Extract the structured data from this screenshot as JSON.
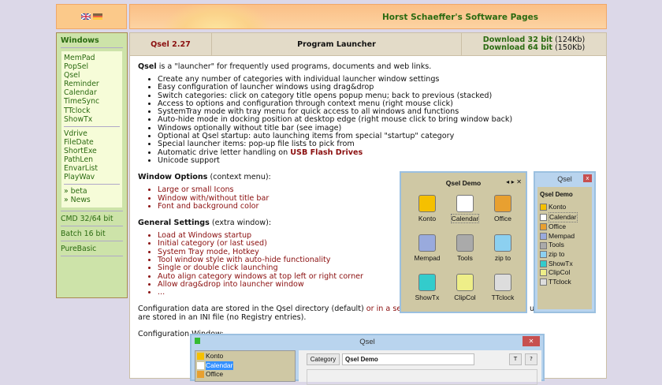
{
  "header": {
    "title": "Horst Schaeffer's Software Pages",
    "flags": [
      "flag-uk-icon",
      "flag-de-icon"
    ]
  },
  "sidebar": {
    "heading": "Windows",
    "group1": [
      "MemPad",
      "PopSel",
      "Qsel",
      "Reminder",
      "Calendar",
      "TimeSync",
      "TTclock",
      "ShowTx"
    ],
    "group2": [
      "Vdrive",
      "FileDate",
      "ShortExe",
      "PathLen",
      "EnvarList",
      "PlayWav"
    ],
    "group3": [
      "» beta",
      "» News"
    ],
    "sections": [
      "CMD 32/64 bit",
      "Batch 16 bit",
      "PureBasic"
    ]
  },
  "tabs": {
    "version": "Qsel 2.27",
    "title": "Program Launcher",
    "dl32": "Download 32 bit",
    "dl32size": "(124Kb)",
    "dl64": "Download 64 bit",
    "dl64size": "(150Kb)"
  },
  "content": {
    "intro_bold": "Qsel",
    "intro": " is a \"launcher\" for frequently used programs, documents and web links.",
    "features": [
      "Create any number of categories with individual launcher window settings",
      "Easy configuration of launcher windows using drag&drop",
      "Switch categories: click on category title opens popup menu; back to previous (stacked)",
      "Access to options and configuration through context menu (right mouse click)",
      "SystemTray mode with tray menu for quick access to all windows and functions",
      "Auto-hide mode in docking position at desktop edge (right mouse click to bring window back)",
      "Windows optionally without title bar (see image)",
      "Optional at Qsel startup: auto launching items from special \"startup\" category",
      "Special launcher items: pop-up file lists to pick from",
      "Automatic drive letter handling on ",
      "Unicode support"
    ],
    "usb_link": "USB Flash Drives",
    "wo_title": "Window Options",
    "wo_note": " (context menu):",
    "wo_items": [
      "Large or small Icons",
      "Window with/without title bar",
      "Font and background color"
    ],
    "gs_title": "General Settings",
    "gs_note": " (extra window):",
    "gs_items": [
      "Load at Windows startup",
      "Initial category (or last used)",
      "System Tray mode, Hotkey",
      "Tool window style with auto-hide functionality",
      "Single or double click launching",
      "Auto align category windows at top left or right corner",
      "Allow drag&drop into launcher window",
      "..."
    ],
    "config1": "Configuration data are stored in the Qsel directory (default) ",
    "config_link": "or in a separate directory",
    "config2": " (for experienced users). Settings are stored in an INI file (no Registry entries).",
    "config_window_label": "Configuration Window:"
  },
  "demo1": {
    "title": "Qsel Demo",
    "items": [
      "Konto",
      "Calendar",
      "Office",
      "Mempad",
      "Tools",
      "zip to",
      "ShowTx",
      "ClipCol",
      "TTclock"
    ]
  },
  "demo2": {
    "wintitle": "Qsel",
    "title": "Qsel Demo",
    "items": [
      "Konto",
      "Calendar",
      "Office",
      "Mempad",
      "Tools",
      "zip to",
      "ShowTx",
      "ClipCol",
      "TTclock"
    ]
  },
  "config_window": {
    "title": "Qsel",
    "items": [
      "Konto",
      "Calendar",
      "Office"
    ],
    "category_btn": "Category",
    "category_value": "Qsel Demo",
    "t_btn": "T",
    "help_btn": "?"
  }
}
